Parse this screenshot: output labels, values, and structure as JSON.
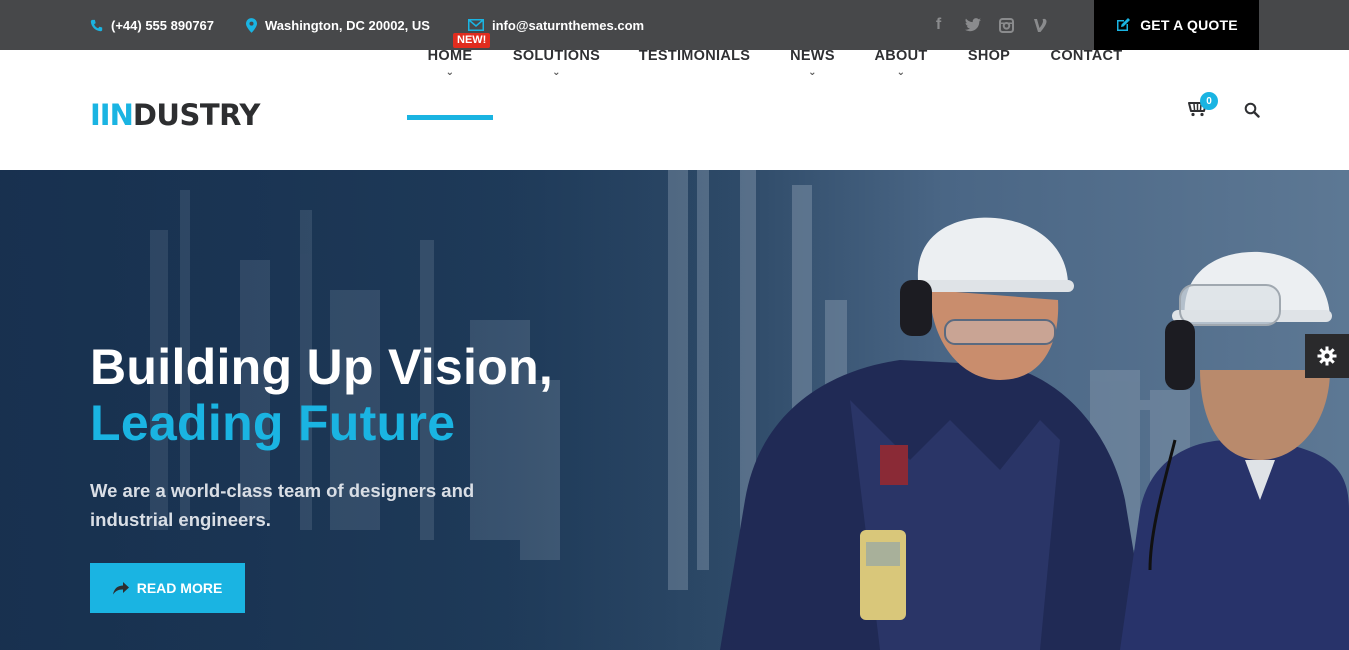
{
  "topbar": {
    "phone": "(+44) 555 890767",
    "address": "Washington, DC 20002, US",
    "email": "info@saturnthemes.com",
    "socials": [
      "facebook-icon",
      "twitter-icon",
      "instagram-icon",
      "vine-icon"
    ],
    "quote_label": "GET A QUOTE"
  },
  "header": {
    "logo_mark": "IIN",
    "logo_text": "DUSTRY",
    "badge": "NEW!",
    "nav": {
      "home": "HOME",
      "solutions": "SOLUTIONS",
      "testimonials": "TESTIMONIALS",
      "news": "NEWS",
      "about": "ABOUT",
      "shop": "SHOP",
      "contact": "CONTACT"
    },
    "cart_count": "0"
  },
  "hero": {
    "title_line1": "Building Up Vision,",
    "title_line2": "Leading Future",
    "subtitle": "We are a world-class team of designers and industrial engineers.",
    "button_label": "READ MORE"
  },
  "colors": {
    "accent": "#1ab4e2",
    "topbar_bg": "#47484a",
    "badge": "#e12c1e",
    "quote_bg": "#000000"
  }
}
